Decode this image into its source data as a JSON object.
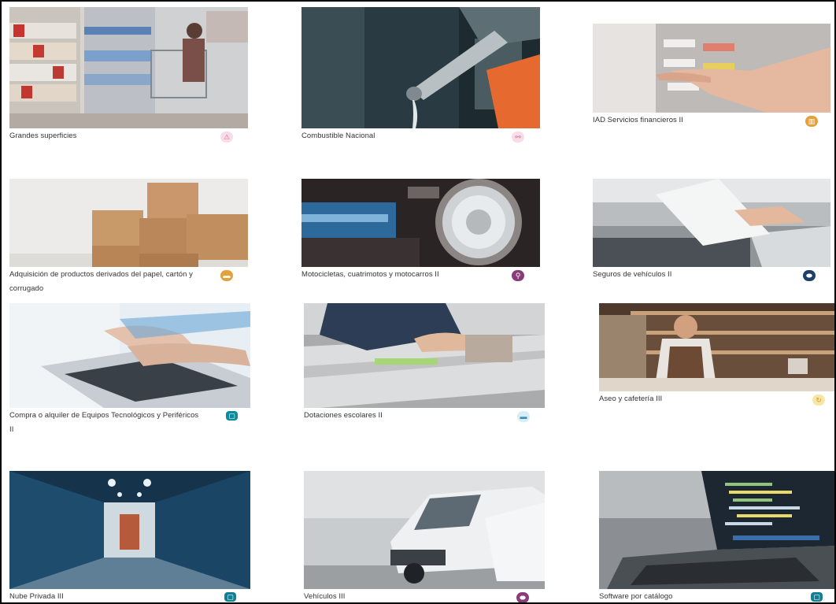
{
  "catalog": {
    "items": [
      {
        "label": "Grandes superficies",
        "icon": "warning-triangle-icon",
        "icon_glyph": "⚠",
        "color": "#f9dcea"
      },
      {
        "label": "Combustible Nacional",
        "icon": "fuel-network-icon",
        "icon_glyph": "⚯",
        "color": "#f9dcea"
      },
      {
        "label": "IAD Servicios financieros II",
        "icon": "bank-icon",
        "icon_glyph": "▥",
        "color": "#e3a13b"
      },
      {
        "label": "Adquisición de productos derivados del papel, cartón y corrugado",
        "icon": "truck-icon",
        "icon_glyph": "▬",
        "color": "#e3a13b"
      },
      {
        "label": "Motocicletas, cuatrimotos y motocarros II",
        "icon": "motorcycle-icon",
        "icon_glyph": "⚲",
        "color": "#8a3c7a"
      },
      {
        "label": "Seguros de vehículos II",
        "icon": "car-insurance-icon",
        "icon_glyph": "⬬",
        "color": "#1f3f68"
      },
      {
        "label": "Compra o alquiler de Equipos Tecnológicos y Periféricos II",
        "icon": "computer-icon",
        "icon_glyph": "▢",
        "color": "#0d8b9c"
      },
      {
        "label": "Dotaciones escolares II",
        "icon": "desk-icon",
        "icon_glyph": "▬",
        "color": "#d8eef6"
      },
      {
        "label": "Aseo y cafetería III",
        "icon": "recycle-icon",
        "icon_glyph": "↻",
        "color": "#f8e6a9"
      },
      {
        "label": "Nube Privada III",
        "icon": "computer-icon",
        "icon_glyph": "▢",
        "color": "#167e93"
      },
      {
        "label": "Vehículos III",
        "icon": "car-icon",
        "icon_glyph": "⬬",
        "color": "#8a3c7a"
      },
      {
        "label": "Software por catálogo",
        "icon": "computer-icon",
        "icon_glyph": "▢",
        "color": "#167e93"
      }
    ]
  }
}
